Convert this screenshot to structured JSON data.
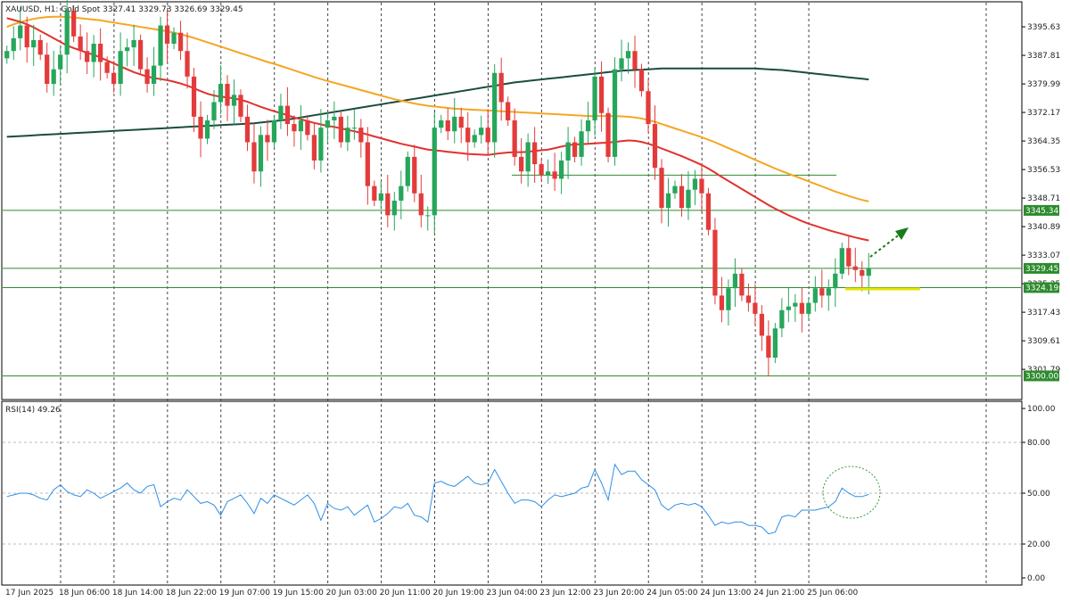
{
  "header": {
    "symbol_line": "XAUUSD, H1:  Gold Spot  3327.41 3329.73 3326.69 3329.45"
  },
  "rsi_panel": {
    "label": "RSI(14) 49.26"
  },
  "colors": {
    "bull": "#26a65b",
    "bear": "#e33b3b",
    "ma_fast": "#e0322f",
    "ma_mid": "#f5a623",
    "ma_slow": "#1b4d3e",
    "rsi": "#2f8fe6",
    "level_line": "#2e8b2e",
    "highlight": "#e6e600",
    "arrow": "#1a7a1a"
  },
  "chart_data": [
    {
      "type": "candlestick",
      "title": "XAUUSD, H1",
      "ylim": [
        3294.0,
        3402.0
      ],
      "y_ticks": [
        "3395.63",
        "3387.81",
        "3379.99",
        "3372.17",
        "3364.35",
        "3356.53",
        "3348.71",
        "3340.89",
        "3333.07",
        "3325.25",
        "3317.43",
        "3309.61",
        "3301.79"
      ],
      "x_tick_labels": [
        "17 Jun 2025",
        "18 Jun 06:00",
        "18 Jun 14:00",
        "18 Jun 22:00",
        "19 Jun 07:00",
        "19 Jun 15:00",
        "20 Jun 03:00",
        "20 Jun 11:00",
        "20 Jun 19:00",
        "23 Jun 04:00",
        "23 Jun 12:00",
        "23 Jun 20:00",
        "24 Jun 05:00",
        "24 Jun 13:00",
        "24 Jun 21:00",
        "25 Jun 06:00"
      ],
      "horizontal_levels": [
        {
          "value": 3345.34,
          "label": "3345.34"
        },
        {
          "value": 3329.45,
          "label": "3329.45"
        },
        {
          "value": 3324.19,
          "label": "3324.19"
        },
        {
          "value": 3300.0,
          "label": "3300.00"
        }
      ],
      "partial_level": 3355.0,
      "close": [
        3389.0,
        3392.5,
        3396.0,
        3390.0,
        3392.0,
        3388.0,
        3380.0,
        3384.0,
        3388.0,
        3400.0,
        3393.0,
        3389.0,
        3386.0,
        3391.0,
        3386.0,
        3383.0,
        3380.0,
        3389.0,
        3390.0,
        3392.0,
        3384.0,
        3380.0,
        3385.0,
        3396.0,
        3391.0,
        3394.0,
        3389.0,
        3382.0,
        3371.0,
        3365.0,
        3370.0,
        3375.0,
        3380.0,
        3374.0,
        3377.0,
        3371.0,
        3364.0,
        3356.0,
        3366.0,
        3364.0,
        3370.0,
        3374.0,
        3369.0,
        3367.0,
        3370.0,
        3366.0,
        3359.0,
        3368.0,
        3370.0,
        3371.0,
        3364.0,
        3368.0,
        3368.0,
        3364.0,
        3352.0,
        3348.0,
        3350.0,
        3344.0,
        3348.0,
        3352.0,
        3360.0,
        3350.0,
        3344.0,
        3344.0,
        3368.0,
        3370.0,
        3367.0,
        3371.0,
        3368.0,
        3364.0,
        3366.0,
        3368.0,
        3364.0,
        3383.0,
        3375.0,
        3370.0,
        3360.0,
        3356.0,
        3364.0,
        3358.0,
        3355.0,
        3356.0,
        3354.0,
        3359.0,
        3364.0,
        3360.0,
        3367.0,
        3370.0,
        3382.0,
        3372.0,
        3360.0,
        3384.0,
        3387.0,
        3389.0,
        3384.0,
        3378.0,
        3369.0,
        3357.0,
        3346.0,
        3350.0,
        3352.0,
        3346.0,
        3351.0,
        3354.0,
        3350.0,
        3340.0,
        3322.0,
        3318.0,
        3324.0,
        3328.0,
        3322.0,
        3320.0,
        3317.0,
        3311.0,
        3305.0,
        3313.0,
        3318.0,
        3319.0,
        3320.0,
        3317.0,
        3320.0,
        3324.0,
        3322.0,
        3324.0,
        3328.0,
        3335.0,
        3330.0,
        3329.0,
        3327.41,
        3329.45
      ],
      "ma_fast": [
        3398,
        3397.5,
        3397,
        3396.3,
        3395.5,
        3394.5,
        3393.5,
        3392.5,
        3391.5,
        3390.5,
        3389.8,
        3389.2,
        3388.5,
        3388,
        3387.2,
        3386.4,
        3385.6,
        3384.8,
        3384,
        3383.2,
        3382.6,
        3382,
        3381.6,
        3381.3,
        3381,
        3380.6,
        3380.1,
        3379.5,
        3378.8,
        3378,
        3377.3,
        3376.8,
        3376.5,
        3376.3,
        3376,
        3375.6,
        3375.1,
        3374.4,
        3373.7,
        3373.1,
        3372.5,
        3372,
        3371.4,
        3370.8,
        3370.3,
        3369.8,
        3369.3,
        3368.9,
        3368.5,
        3368.2,
        3367.8,
        3367.4,
        3367,
        3366.6,
        3366.1,
        3365.6,
        3365.1,
        3364.6,
        3364.1,
        3363.6,
        3363.2,
        3362.8,
        3362.4,
        3362,
        3361.8,
        3361.6,
        3361.4,
        3361.2,
        3361,
        3360.8,
        3360.7,
        3360.6,
        3360.5,
        3360.8,
        3361,
        3361.2,
        3361.3,
        3361.3,
        3361.4,
        3361.6,
        3361.8,
        3362,
        3362.4,
        3362.8,
        3363.2,
        3363.4,
        3363.5,
        3363.6,
        3363.7,
        3363.8,
        3363.9,
        3364.1,
        3364.3,
        3364.5,
        3364.4,
        3364.1,
        3363.6,
        3363,
        3362.3,
        3361.6,
        3360.9,
        3360.2,
        3359.4,
        3358.6,
        3357.8,
        3356.8,
        3355.7,
        3354.5,
        3353.4,
        3352.3,
        3351.2,
        3350.1,
        3349,
        3347.9,
        3346.8,
        3345.8,
        3344.9,
        3344,
        3343.2,
        3342.4,
        3341.7,
        3341.1,
        3340.5,
        3339.9,
        3339.4,
        3338.9,
        3338.4,
        3337.9,
        3337.5,
        3337.1
      ],
      "ma_mid": [
        3395.6,
        3396.3,
        3396.9,
        3397.4,
        3397.8,
        3398.1,
        3398.3,
        3398.4,
        3398.4,
        3398.3,
        3398.2,
        3398,
        3397.8,
        3397.6,
        3397.4,
        3397.1,
        3396.8,
        3396.5,
        3396.2,
        3395.9,
        3395.6,
        3395.3,
        3395,
        3394.7,
        3394.4,
        3394,
        3393.6,
        3393.1,
        3392.6,
        3392,
        3391.4,
        3390.8,
        3390.2,
        3389.6,
        3389,
        3388.4,
        3387.8,
        3387.2,
        3386.6,
        3386,
        3385.5,
        3384.9,
        3384.3,
        3383.7,
        3383.1,
        3382.5,
        3381.9,
        3381.3,
        3380.8,
        3380.3,
        3379.8,
        3379.3,
        3378.8,
        3378.3,
        3377.8,
        3377.3,
        3376.8,
        3376.3,
        3375.8,
        3375.4,
        3375,
        3374.6,
        3374.3,
        3374,
        3373.8,
        3373.6,
        3373.4,
        3373.2,
        3373.1,
        3373,
        3372.9,
        3372.8,
        3372.7,
        3372.6,
        3372.5,
        3372.4,
        3372.3,
        3372.2,
        3372.1,
        3372,
        3371.9,
        3371.8,
        3371.7,
        3371.6,
        3371.5,
        3371.4,
        3371.3,
        3371.2,
        3371.2,
        3371.2,
        3371.2,
        3371.2,
        3371.1,
        3371,
        3370.8,
        3370.5,
        3370.1,
        3369.6,
        3369,
        3368.4,
        3367.8,
        3367.2,
        3366.6,
        3366,
        3365.4,
        3364.7,
        3364,
        3363.2,
        3362.4,
        3361.6,
        3360.8,
        3360,
        3359.2,
        3358.4,
        3357.6,
        3356.8,
        3356.1,
        3355.4,
        3354.7,
        3354,
        3353.3,
        3352.6,
        3351.9,
        3351.2,
        3350.5,
        3349.9,
        3349.3,
        3348.7,
        3348.2,
        3347.8
      ],
      "ma_slow": [
        3365.5,
        3365.6,
        3365.7,
        3365.8,
        3365.9,
        3366,
        3366.1,
        3366.2,
        3366.3,
        3366.4,
        3366.5,
        3366.6,
        3366.7,
        3366.8,
        3366.9,
        3367,
        3367.1,
        3367.2,
        3367.3,
        3367.4,
        3367.5,
        3367.6,
        3367.7,
        3367.8,
        3367.9,
        3368,
        3368.1,
        3368.2,
        3368.3,
        3368.4,
        3368.5,
        3368.6,
        3368.7,
        3368.8,
        3368.9,
        3369,
        3369.1,
        3369.2,
        3369.4,
        3369.6,
        3369.8,
        3370,
        3370.2,
        3370.5,
        3370.8,
        3371.1,
        3371.4,
        3371.7,
        3372,
        3372.3,
        3372.6,
        3372.9,
        3373.2,
        3373.5,
        3373.8,
        3374.1,
        3374.4,
        3374.7,
        3375,
        3375.3,
        3375.6,
        3375.9,
        3376.2,
        3376.5,
        3376.8,
        3377.1,
        3377.4,
        3377.7,
        3378,
        3378.3,
        3378.6,
        3378.9,
        3379.2,
        3379.5,
        3379.8,
        3380.1,
        3380.4,
        3380.6,
        3380.8,
        3381,
        3381.2,
        3381.4,
        3381.6,
        3381.8,
        3382,
        3382.2,
        3382.4,
        3382.6,
        3382.8,
        3383,
        3383.2,
        3383.4,
        3383.6,
        3383.7,
        3383.8,
        3383.9,
        3384,
        3384.1,
        3384.2,
        3384.2,
        3384.2,
        3384.2,
        3384.2,
        3384.2,
        3384.2,
        3384.2,
        3384.2,
        3384.2,
        3384.2,
        3384.2,
        3384.2,
        3384.2,
        3384.2,
        3384.1,
        3384,
        3383.9,
        3383.8,
        3383.6,
        3383.4,
        3383.2,
        3383,
        3382.8,
        3382.6,
        3382.4,
        3382.2,
        3382,
        3381.8,
        3381.6,
        3381.4,
        3381.2
      ]
    },
    {
      "type": "line",
      "title": "RSI(14) 49.26",
      "ylim": [
        0,
        100
      ],
      "y_ticks": [
        "100.00",
        "80.00",
        "50.00",
        "20.00",
        "0.00"
      ],
      "levels": [
        80,
        50,
        20
      ],
      "values": [
        48,
        49,
        50,
        50,
        49,
        47,
        46,
        52,
        55,
        51,
        49,
        48,
        52,
        50,
        47,
        49,
        51,
        53,
        56,
        52,
        50,
        54,
        55,
        42,
        45,
        47,
        46,
        52,
        48,
        44,
        45,
        43,
        37,
        45,
        47,
        49,
        44,
        38,
        47,
        44,
        49,
        47,
        45,
        43,
        46,
        49,
        44,
        34,
        44,
        41,
        40,
        42,
        37,
        40,
        43,
        33,
        35,
        38,
        42,
        41,
        44,
        37,
        36,
        33,
        56,
        57,
        55,
        54,
        57,
        60,
        56,
        55,
        56,
        64,
        57,
        50,
        44,
        46,
        46,
        45,
        42,
        46,
        49,
        48,
        49,
        50,
        53,
        54,
        64,
        56,
        46,
        67,
        61,
        63,
        63,
        58,
        55,
        52,
        43,
        40,
        43,
        44,
        43,
        44,
        42,
        37,
        31,
        33,
        32,
        33,
        33,
        31,
        31,
        30,
        26,
        27,
        36,
        37,
        36,
        40,
        40,
        40,
        41,
        42,
        45,
        53,
        50,
        48,
        48,
        49.26
      ]
    }
  ]
}
